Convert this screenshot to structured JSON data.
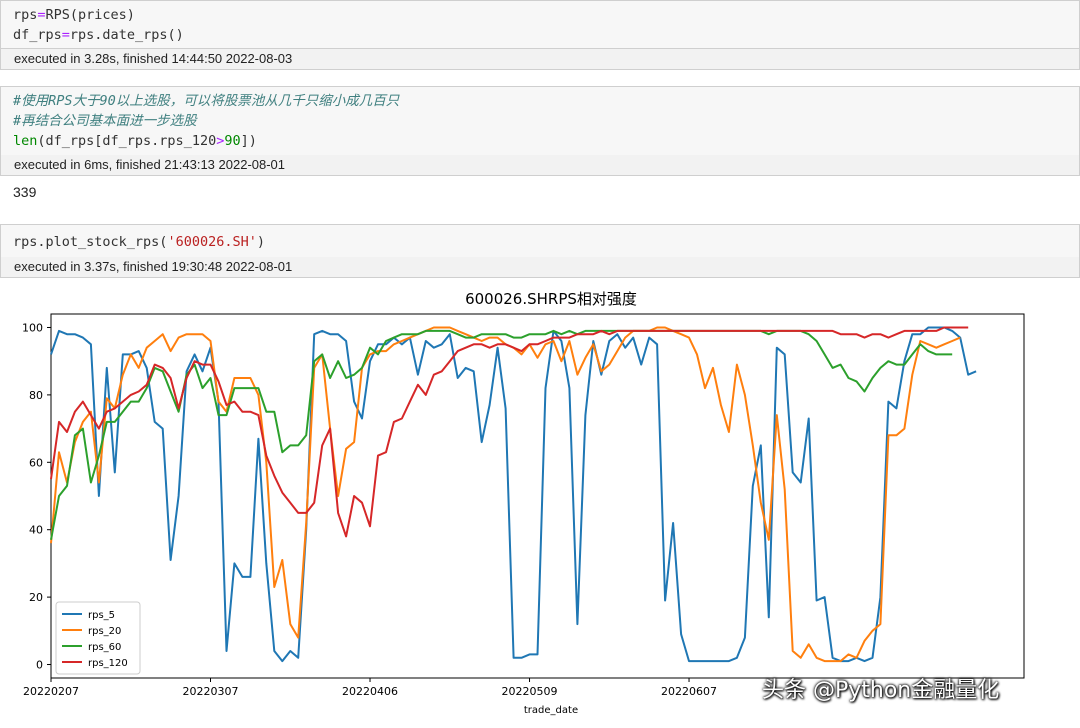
{
  "cells": [
    {
      "input_lines": [
        [
          {
            "t": "rps"
          },
          {
            "t": "=",
            "c": "op"
          },
          {
            "t": "RPS(prices)"
          }
        ],
        [
          {
            "t": "df_rps"
          },
          {
            "t": "=",
            "c": "op"
          },
          {
            "t": "rps.date_rps()"
          }
        ]
      ],
      "exec_info": "executed in 3.28s, finished 14:44:50 2022-08-03"
    },
    {
      "input_lines": [
        [
          {
            "t": "#使用RPS大于90以上选股，可以将股票池从几千只缩小成几百只",
            "c": "cm"
          }
        ],
        [
          {
            "t": "#再结合公司基本面进一步选股",
            "c": "cm"
          }
        ],
        [
          {
            "t": "len",
            "c": "num"
          },
          {
            "t": "(df_rps[df_rps.rps_120"
          },
          {
            "t": ">",
            "c": "op"
          },
          {
            "t": "90",
            "c": "num"
          },
          {
            "t": "])"
          }
        ]
      ],
      "exec_info": "executed in 6ms, finished 21:43:13 2022-08-01",
      "output": "339"
    },
    {
      "input_lines": [
        [
          {
            "t": "rps.plot_stock_rps("
          },
          {
            "t": "'600026.SH'",
            "c": "str"
          },
          {
            "t": ")"
          }
        ]
      ],
      "exec_info": "executed in 3.37s, finished 19:30:48 2022-08-01"
    }
  ],
  "watermark": "头条 @Python金融量化",
  "chart_data": {
    "type": "line",
    "title": "600026.SHRPS相对强度",
    "xlabel": "trade_date",
    "ylabel": "",
    "ylim": [
      -4,
      104
    ],
    "yticks": [
      0,
      20,
      40,
      60,
      80,
      100
    ],
    "x_range": [
      0,
      122
    ],
    "xticks": [
      {
        "pos": 0,
        "label": "20220207"
      },
      {
        "pos": 20,
        "label": "20220307"
      },
      {
        "pos": 40,
        "label": "20220406"
      },
      {
        "pos": 60,
        "label": "20220509"
      },
      {
        "pos": 80,
        "label": "20220607"
      }
    ],
    "grid": false,
    "legend": "lower-left",
    "series": [
      {
        "name": "rps_5",
        "color": "#1f77b4",
        "values": [
          92,
          99,
          98,
          98,
          97,
          95,
          50,
          88,
          57,
          92,
          92,
          93,
          88,
          72,
          70,
          31,
          50,
          87,
          92,
          87,
          94,
          78,
          4,
          30,
          26,
          26,
          67,
          30,
          4,
          1,
          4,
          2,
          40,
          98,
          99,
          98,
          98,
          96,
          78,
          73,
          90,
          95,
          95,
          97,
          95,
          97,
          86,
          96,
          94,
          95,
          98,
          85,
          88,
          87,
          66,
          77,
          94,
          76,
          2,
          2,
          3,
          3,
          82,
          99,
          96,
          82,
          12,
          74,
          96,
          86,
          96,
          98,
          94,
          97,
          89,
          97,
          95,
          19,
          42,
          9,
          1,
          1,
          1,
          1,
          1,
          1,
          2,
          8,
          53,
          65,
          14,
          94,
          92,
          57,
          54,
          73,
          19,
          20,
          2,
          1,
          1,
          2,
          1,
          2,
          20,
          78,
          76,
          90,
          98,
          98,
          100,
          100,
          100,
          99,
          97,
          86,
          87
        ]
      },
      {
        "name": "rps_20",
        "color": "#ff7f0e",
        "values": [
          36,
          63,
          54,
          66,
          72,
          75,
          54,
          79,
          76,
          86,
          92,
          88,
          94,
          96,
          98,
          93,
          97,
          98,
          98,
          98,
          96,
          78,
          75,
          85,
          85,
          85,
          80,
          60,
          23,
          31,
          12,
          8,
          42,
          88,
          92,
          70,
          50,
          64,
          66,
          88,
          92,
          93,
          93,
          95,
          96,
          97,
          98,
          99,
          100,
          100,
          100,
          99,
          98,
          97,
          96,
          97,
          97,
          95,
          94,
          92,
          95,
          91,
          95,
          96,
          90,
          96,
          86,
          91,
          95,
          87,
          89,
          93,
          97,
          99,
          99,
          99,
          100,
          100,
          99,
          98,
          97,
          92,
          82,
          88,
          77,
          69,
          89,
          80,
          65,
          48,
          37,
          74,
          52,
          4,
          2,
          6,
          2,
          1,
          1,
          1,
          3,
          2,
          7,
          10,
          12,
          68,
          68,
          70,
          86,
          96,
          95,
          94,
          95,
          96,
          97
        ]
      },
      {
        "name": "rps_60",
        "color": "#2ca02c",
        "values": [
          37,
          50,
          53,
          68,
          70,
          54,
          62,
          72,
          72,
          75,
          78,
          78,
          82,
          88,
          87,
          81,
          75,
          86,
          89,
          82,
          85,
          74,
          74,
          82,
          82,
          82,
          82,
          75,
          75,
          63,
          65,
          65,
          68,
          90,
          92,
          85,
          90,
          85,
          86,
          88,
          94,
          92,
          96,
          97,
          98,
          98,
          98,
          99,
          99,
          99,
          99,
          98,
          97,
          97,
          98,
          98,
          98,
          98,
          97,
          97,
          98,
          98,
          98,
          99,
          98,
          99,
          98,
          99,
          99,
          99,
          99,
          99,
          99,
          99,
          99,
          99,
          99,
          99,
          99,
          99,
          99,
          99,
          99,
          99,
          99,
          99,
          99,
          99,
          99,
          99,
          98,
          99,
          99,
          99,
          99,
          98,
          96,
          92,
          88,
          89,
          85,
          84,
          81,
          85,
          88,
          90,
          89,
          89,
          92,
          95,
          93,
          92,
          92,
          92
        ]
      },
      {
        "name": "rps_120",
        "color": "#d62728",
        "values": [
          55,
          72,
          69,
          75,
          78,
          74,
          70,
          75,
          76,
          78,
          80,
          81,
          83,
          89,
          88,
          85,
          76,
          85,
          90,
          89,
          89,
          84,
          77,
          78,
          75,
          75,
          74,
          62,
          56,
          51,
          48,
          45,
          45,
          48,
          65,
          70,
          45,
          38,
          50,
          48,
          41,
          62,
          63,
          72,
          73,
          78,
          83,
          80,
          86,
          87,
          90,
          93,
          94,
          95,
          95,
          94,
          95,
          95,
          94,
          93,
          95,
          95,
          96,
          97,
          97,
          97,
          98,
          98,
          98,
          99,
          98,
          99,
          99,
          99,
          99,
          99,
          99,
          99,
          99,
          99,
          99,
          99,
          99,
          99,
          99,
          99,
          99,
          99,
          99,
          99,
          99,
          99,
          99,
          99,
          99,
          99,
          99,
          99,
          99,
          98,
          98,
          98,
          97,
          98,
          98,
          97,
          98,
          99,
          99,
          99,
          99,
          99,
          100,
          100,
          100,
          100
        ]
      }
    ]
  }
}
